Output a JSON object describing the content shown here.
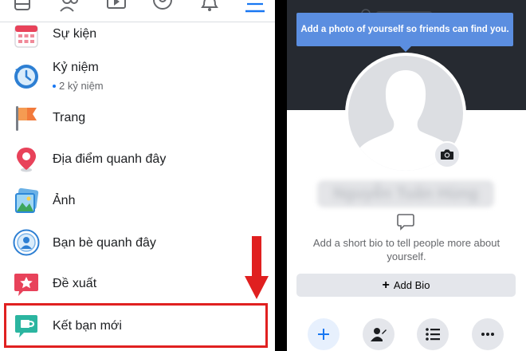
{
  "left_panel": {
    "menu_items": [
      {
        "label": "Sự kiện",
        "icon": "calendar-icon"
      },
      {
        "label": "Kỷ niệm",
        "sublabel": "2 kỷ niệm",
        "icon": "memories-clock-icon"
      },
      {
        "label": "Trang",
        "icon": "flag-icon"
      },
      {
        "label": "Địa điểm quanh đây",
        "icon": "location-pin-icon"
      },
      {
        "label": "Ảnh",
        "icon": "photos-icon"
      },
      {
        "label": "Bạn bè quanh đây",
        "icon": "nearby-friends-icon"
      },
      {
        "label": "Đề xuất",
        "icon": "recommendations-icon"
      },
      {
        "label": "Kết bạn mới",
        "icon": "new-friends-icon"
      }
    ],
    "colors": {
      "highlight": "#e02020",
      "accent": "#1877f2"
    }
  },
  "right_panel": {
    "tooltip": "Add a photo of yourself so friends can find you.",
    "name_blurred": "Nguyễn Tuấn Hùng",
    "bio_prompt": "Add a short bio to tell people more about yourself.",
    "add_bio_label": "Add Bio",
    "colors": {
      "cover": "#262a31",
      "tooltip": "#5b8ee0"
    }
  }
}
